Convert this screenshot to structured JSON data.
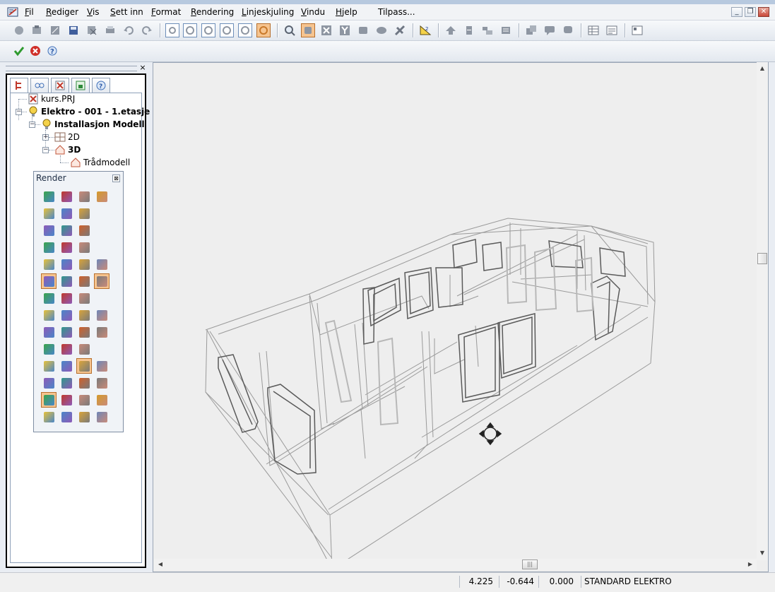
{
  "menubar": {
    "items": [
      "Fil",
      "Rediger",
      "Vis",
      "Sett inn",
      "Format",
      "Rendering",
      "Linjeskjuling",
      "Vindu",
      "Hjelp",
      "Tilpass..."
    ],
    "underline": [
      "F",
      "R",
      "V",
      "S",
      "F",
      "R",
      "L",
      "V",
      "H",
      ""
    ]
  },
  "window_controls": {
    "minimize": "_",
    "restore": "❐",
    "close": "✕"
  },
  "command_combo": {
    "value": ""
  },
  "panel_close": "×",
  "tree": {
    "project": "kurs.PRJ",
    "drawing": "Elektro - 001 - 1.etasje",
    "model": "Installasjon Modell",
    "view2d": "2D",
    "view3d": "3D",
    "wire": "Trådmodell"
  },
  "render_palette": {
    "title": "Render",
    "close": "⊠"
  },
  "status": {
    "x": "4.225",
    "y": "-0.644",
    "z": "0.000",
    "standard": "STANDARD ELEKTRO"
  },
  "colors": {
    "accent_pressed": "#f6c48f",
    "viewport_bg": "#eeeeee",
    "wireframe": "#9a9a9a",
    "wireframe_heavy": "#5a5a5a"
  }
}
